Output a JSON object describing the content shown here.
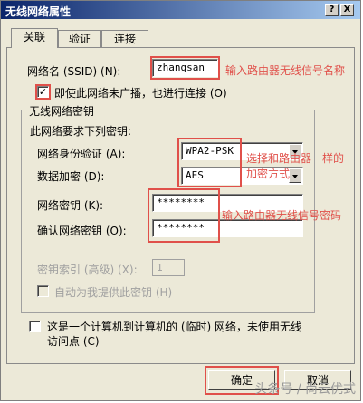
{
  "window": {
    "title": "无线网络属性",
    "help_btn": "?",
    "close_btn": "X"
  },
  "tabs": [
    "关联",
    "验证",
    "连接"
  ],
  "network_name": {
    "label": "网络名 (SSID) (N):",
    "value": "zhangsan"
  },
  "broadcast_checkbox": {
    "label": "即使此网络未广播，也进行连接 (O)",
    "checked": "✓"
  },
  "key_group": {
    "title": "无线网络密钥",
    "subtitle": "此网络要求下列密钥:",
    "auth_label": "网络身份验证 (A):",
    "auth_value": "WPA2-PSK",
    "encryption_label": "数据加密 (D):",
    "encryption_value": "AES",
    "key_label": "网络密钥 (K):",
    "key_value": "********",
    "confirm_label": "确认网络密钥 (O):",
    "confirm_value": "********",
    "index_label": "密钥索引 (高级) (X):",
    "index_value": "1",
    "auto_key_label": "自动为我提供此密钥 (H)"
  },
  "adhoc_checkbox": {
    "label": "这是一个计算机到计算机的 (临时) 网络，未使用无线访问点 (C)"
  },
  "annotations": {
    "ssid": "输入路由器无线信号名称",
    "auth": "选择和路由器一样的加密方式",
    "key": "输入路由器无线信号密码"
  },
  "buttons": {
    "ok": "确定",
    "cancel": "取消"
  },
  "watermark": "头条号 / 尚云优式"
}
